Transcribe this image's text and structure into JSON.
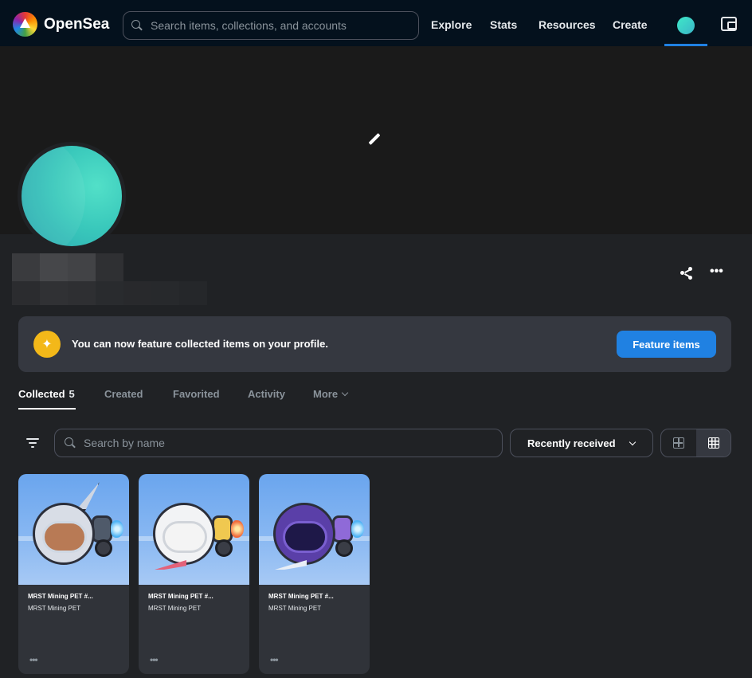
{
  "nav": {
    "brand": "OpenSea",
    "search_placeholder": "Search items, collections, and accounts",
    "links": [
      "Explore",
      "Stats",
      "Resources",
      "Create"
    ]
  },
  "feature_banner": {
    "text": "You can now feature collected items on your profile.",
    "button": "Feature items"
  },
  "tabs": [
    {
      "label": "Collected",
      "count": "5"
    },
    {
      "label": "Created"
    },
    {
      "label": "Favorited"
    },
    {
      "label": "Activity"
    },
    {
      "label": "More"
    }
  ],
  "filters": {
    "search_placeholder": "Search by name",
    "sort": "Recently received"
  },
  "items": [
    {
      "title": "MRST Mining PET #...",
      "collection": "MRST Mining PET"
    },
    {
      "title": "MRST Mining PET #...",
      "collection": "MRST Mining PET"
    },
    {
      "title": "MRST Mining PET #...",
      "collection": "MRST Mining PET"
    }
  ],
  "colors": {
    "accent": "#2081e2",
    "nav_bg": "#04111d",
    "page_bg": "#202225",
    "card_bg": "#303339",
    "badge": "#f3b819"
  },
  "icons": [
    "search-icon",
    "edit-icon",
    "share-icon",
    "more-icon",
    "sparkle-icon",
    "filter-icon",
    "chevron-down-icon",
    "grid-large-icon",
    "grid-small-icon",
    "wallet-icon"
  ]
}
